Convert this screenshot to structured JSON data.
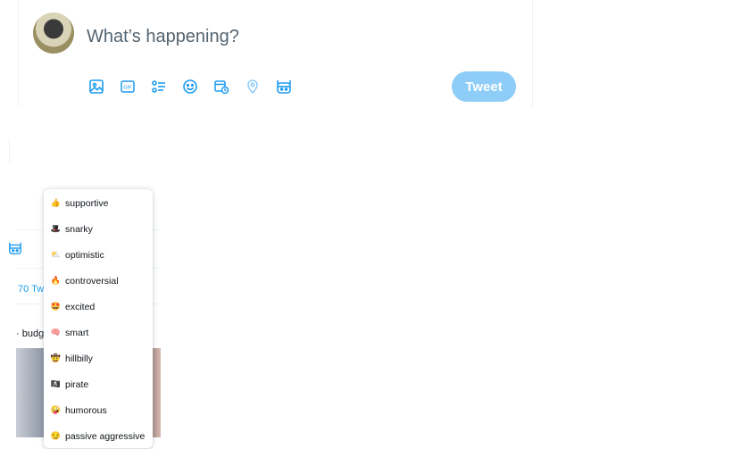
{
  "composer": {
    "prompt": "What’s happening?",
    "tweet_label": "Tweet",
    "tools": [
      {
        "name": "image-icon"
      },
      {
        "name": "gif-icon"
      },
      {
        "name": "poll-icon"
      },
      {
        "name": "emoji-icon"
      },
      {
        "name": "schedule-icon"
      },
      {
        "name": "location-icon"
      },
      {
        "name": "bot-icon"
      }
    ]
  },
  "feed": {
    "count_fragment": "70 Tw",
    "snippet_fragment": "· budge"
  },
  "menu": {
    "items": [
      {
        "emoji": "👍",
        "label": "supportive"
      },
      {
        "emoji": "🎩",
        "label": "snarky"
      },
      {
        "emoji": "⛅",
        "label": "optimistic"
      },
      {
        "emoji": "🔥",
        "label": "controversial"
      },
      {
        "emoji": "🤩",
        "label": "excited"
      },
      {
        "emoji": "🧠",
        "label": "smart"
      },
      {
        "emoji": "🤠",
        "label": "hillbilly"
      },
      {
        "emoji": "🏴‍☠️",
        "label": "pirate"
      },
      {
        "emoji": "🤪",
        "label": "humorous"
      },
      {
        "emoji": "😏",
        "label": "passive aggressive"
      }
    ]
  },
  "colors": {
    "accent": "#1d9bf0",
    "accent_disabled": "#8ecdf8",
    "muted_text": "#536471"
  }
}
